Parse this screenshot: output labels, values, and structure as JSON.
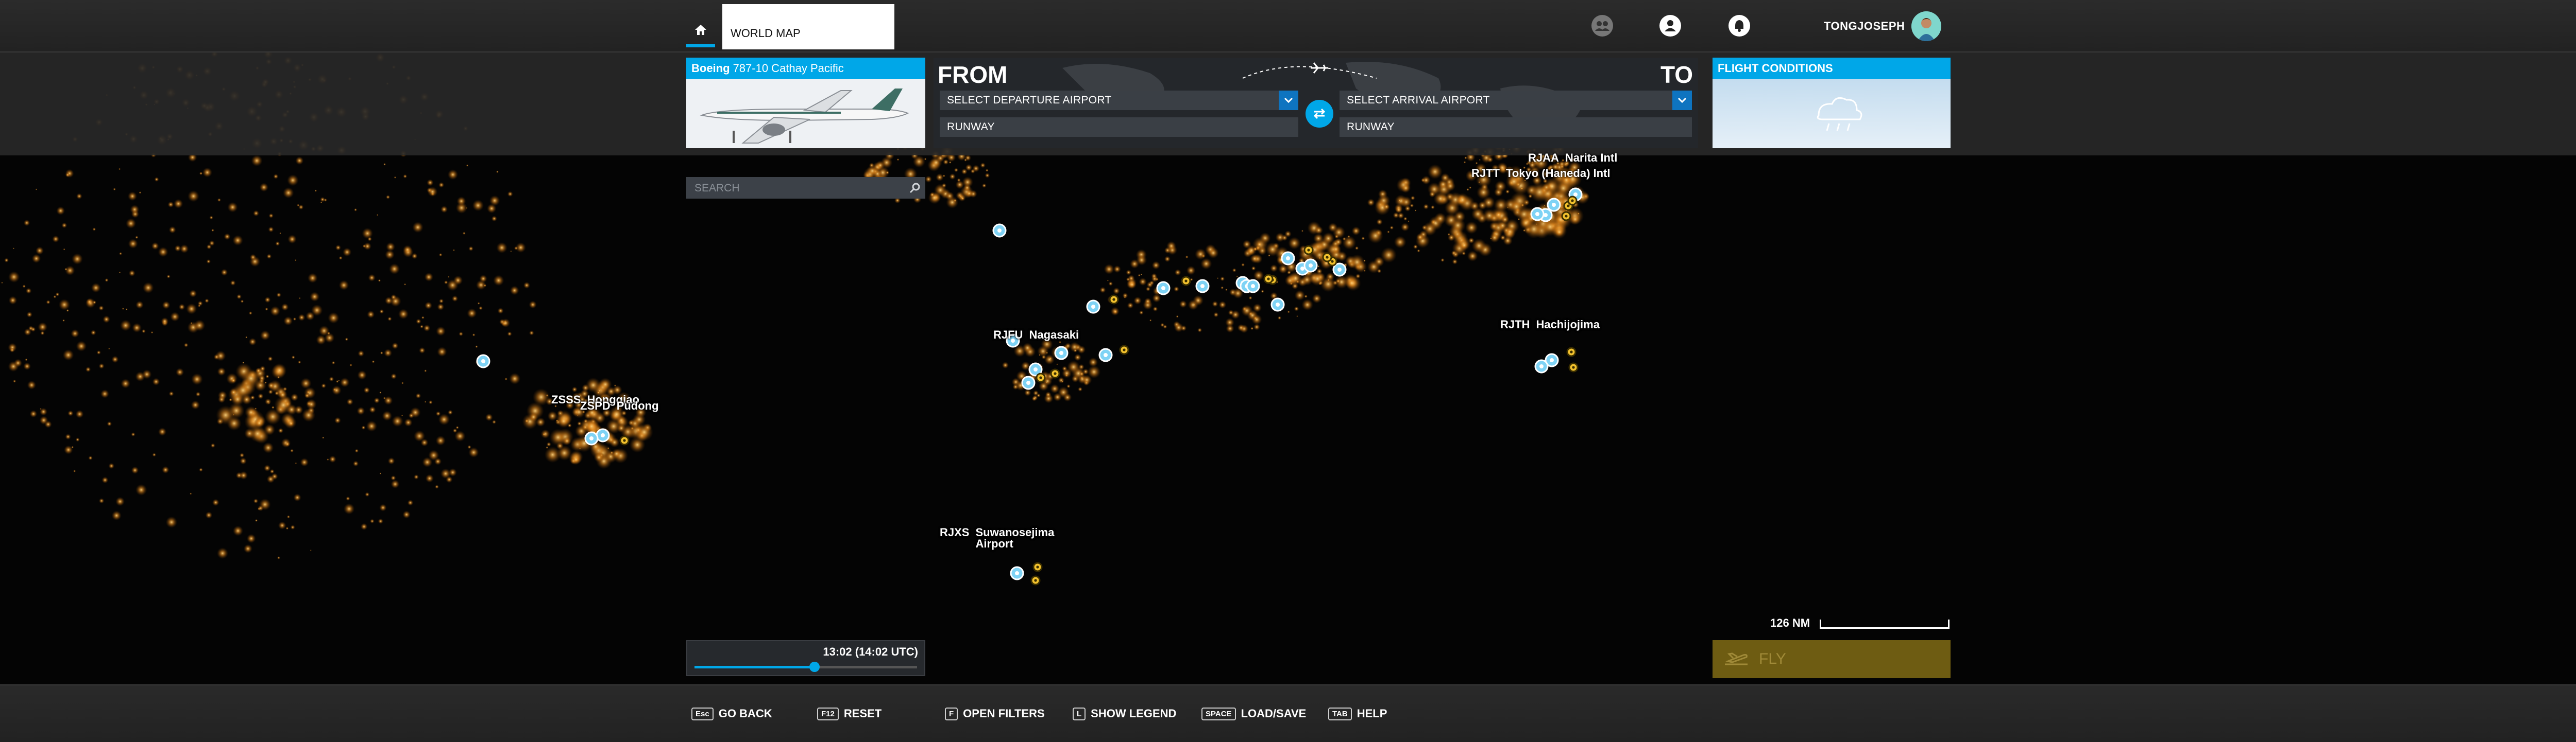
{
  "header": {
    "world_map_tab": "WORLD MAP",
    "username": "TONGJOSEPH",
    "icons": [
      "home-icon",
      "friends-icon",
      "profile-icon",
      "notifications-icon"
    ]
  },
  "aircraft": {
    "make": "Boeing",
    "model": "787-10 Cathay Pacific"
  },
  "route": {
    "from_label": "FROM",
    "to_label": "TO",
    "departure_placeholder": "SELECT DEPARTURE AIRPORT",
    "arrival_placeholder": "SELECT ARRIVAL AIRPORT",
    "departure_runway": "RUNWAY",
    "arrival_runway": "RUNWAY"
  },
  "conditions": {
    "title": "FLIGHT CONDITIONS"
  },
  "search": {
    "placeholder": "SEARCH"
  },
  "time": {
    "display": "13:02 (14:02 UTC)",
    "progress": 0.54
  },
  "scale": {
    "label": "126 NM"
  },
  "fly": {
    "label": "FLY"
  },
  "map_labels": [
    {
      "code": "RJAA",
      "name": "Narita Intl"
    },
    {
      "code": "RJTT",
      "name": "Tokyo (Haneda) Intl"
    },
    {
      "code": "RJTH",
      "name": "Hachijojima"
    },
    {
      "code": "RJFU",
      "name": "Nagasaki"
    },
    {
      "code": "ZSSS",
      "name": "Hongqiao"
    },
    {
      "code": "ZSPD",
      "name": "Pudong"
    },
    {
      "code": "RJXS",
      "name": "Suwanosejima Airport"
    }
  ],
  "footer": {
    "go_back": {
      "key": "Esc",
      "label": "GO BACK"
    },
    "reset": {
      "key": "F12",
      "label": "RESET"
    },
    "open_filters": {
      "key": "F",
      "label": "OPEN FILTERS"
    },
    "show_legend": {
      "key": "L",
      "label": "SHOW LEGEND"
    },
    "load_save": {
      "key": "SPACE",
      "label": "LOAD/SAVE"
    },
    "help": {
      "key": "TAB",
      "label": "HELP"
    }
  },
  "colors": {
    "accent": "#00a7e8",
    "city_lights": "#ffb347",
    "fly_disabled": "#6e5c12"
  }
}
